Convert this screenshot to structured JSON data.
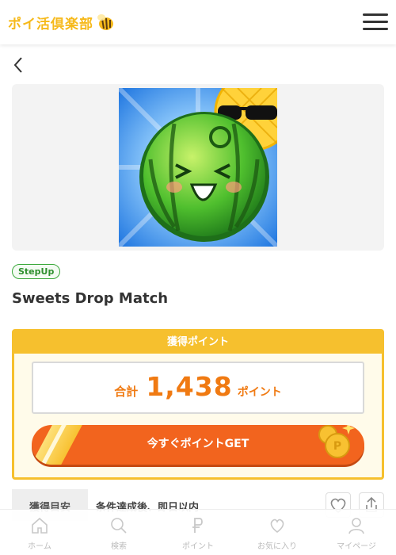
{
  "header": {
    "logo_text": "ポイ活倶楽部",
    "logo_icon": "bee-icon",
    "menu_icon": "hamburger-icon"
  },
  "back_icon": "chevron-left-icon",
  "offer": {
    "badge": "StepUp",
    "title": "Sweets Drop Match",
    "points_heading": "獲得ポイント",
    "total_label": "合計",
    "total_value": "1,438",
    "total_unit": "ポイント",
    "cta_label": "今すぐポイントGET"
  },
  "info": {
    "label": "獲得目安",
    "value": "条件達成後、即日以内"
  },
  "actions": {
    "favorite_icon": "heart-icon",
    "share_icon": "share-icon"
  },
  "bottom_nav": [
    {
      "label": "ホーム",
      "icon": "home-icon"
    },
    {
      "label": "検索",
      "icon": "search-icon"
    },
    {
      "label": "ポイント",
      "icon": "point-icon"
    },
    {
      "label": "お気に入り",
      "icon": "heart-icon"
    },
    {
      "label": "マイページ",
      "icon": "user-icon"
    }
  ],
  "colors": {
    "brand": "#f6b91a",
    "accent": "#f2641e",
    "badge": "#3aa83a",
    "points_border": "#f6c02e"
  }
}
